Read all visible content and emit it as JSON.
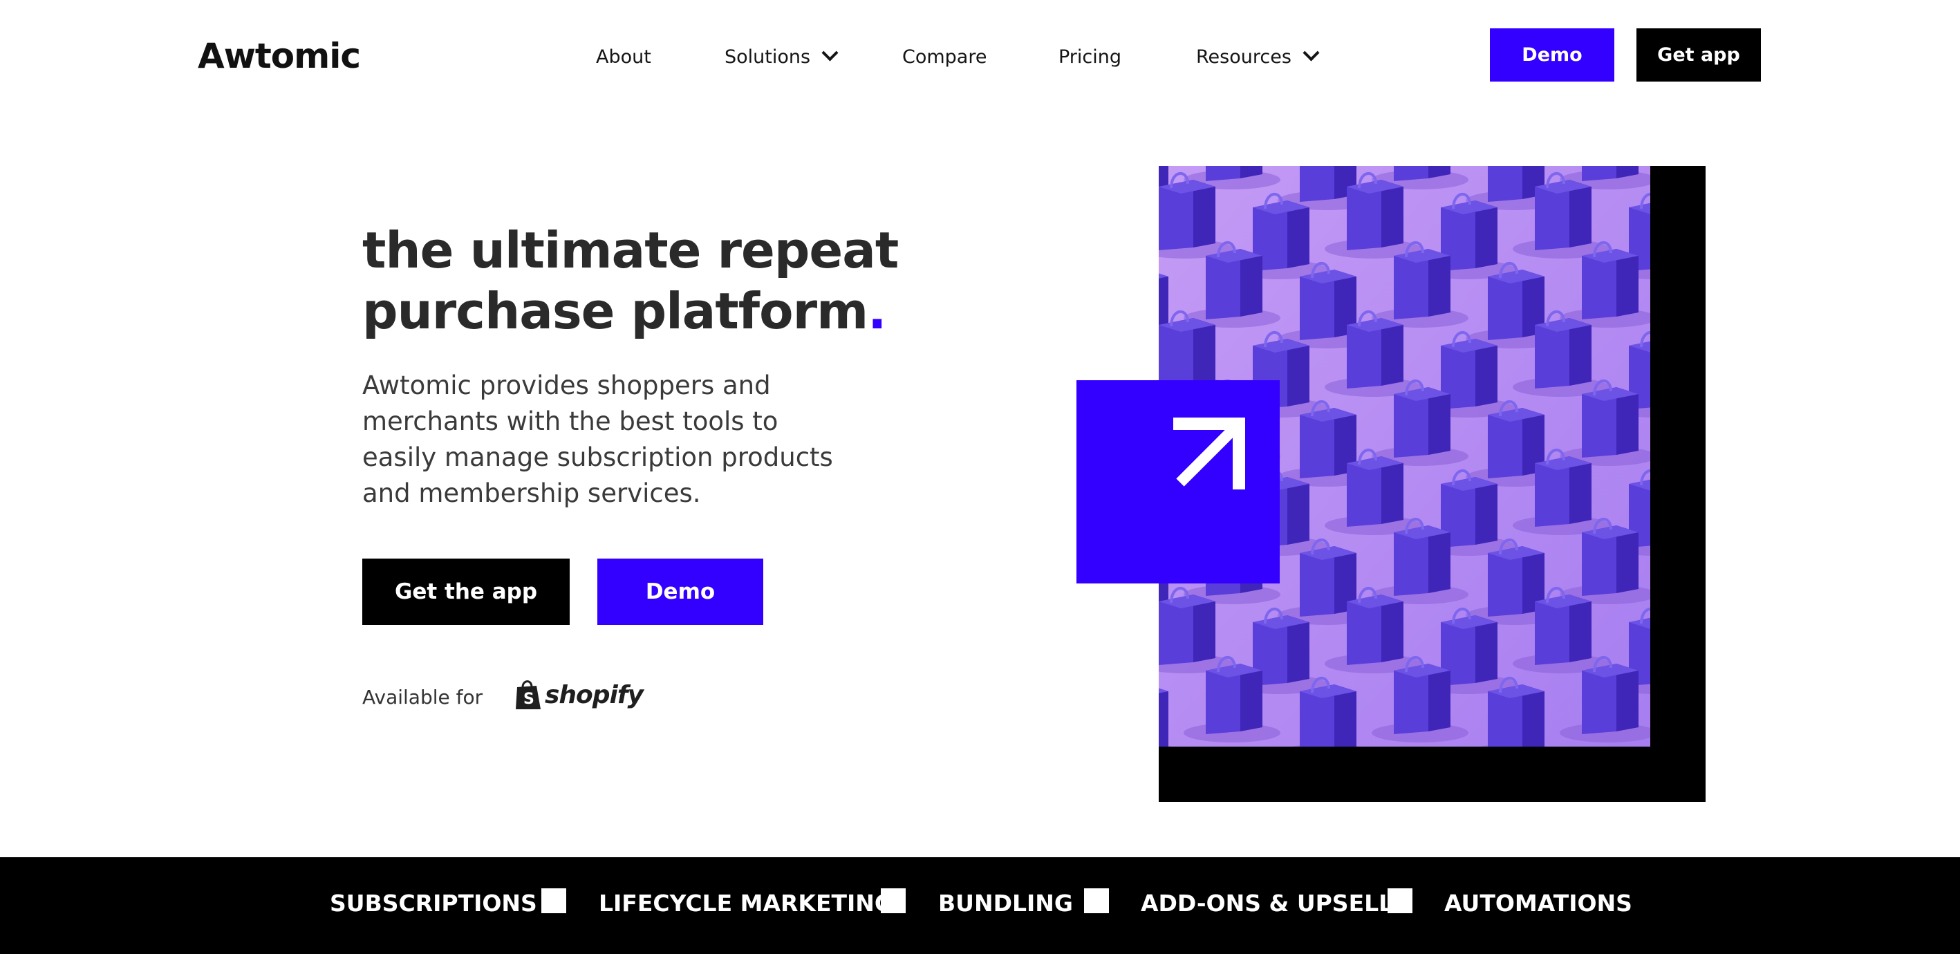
{
  "brand": {
    "logo_text": "Awtomic",
    "accent": "#3300ff"
  },
  "nav": {
    "items": [
      {
        "label": "About"
      },
      {
        "label": "Solutions",
        "dropdown": true
      },
      {
        "label": "Compare"
      },
      {
        "label": "Pricing"
      },
      {
        "label": "Resources",
        "dropdown": true
      }
    ],
    "demo_button": "Demo",
    "get_app_button": "Get app"
  },
  "hero": {
    "title_line1": "the ultimate repeat",
    "title_line2": "purchase platform",
    "title_dot": ".",
    "description": "Awtomic provides shoppers and merchants with the best tools to easily manage subscription products and membership services.",
    "primary_button": "Get the app",
    "secondary_button": "Demo",
    "available_for": "Available for",
    "platform_logo": "shopify"
  },
  "image": {
    "icon": "arrow-up-right-icon"
  },
  "features": {
    "items": [
      "SUBSCRIPTIONS",
      "LIFECYCLE MARKETING",
      "BUNDLING",
      "ADD-ONS & UPSELLS",
      "AUTOMATIONS"
    ]
  }
}
